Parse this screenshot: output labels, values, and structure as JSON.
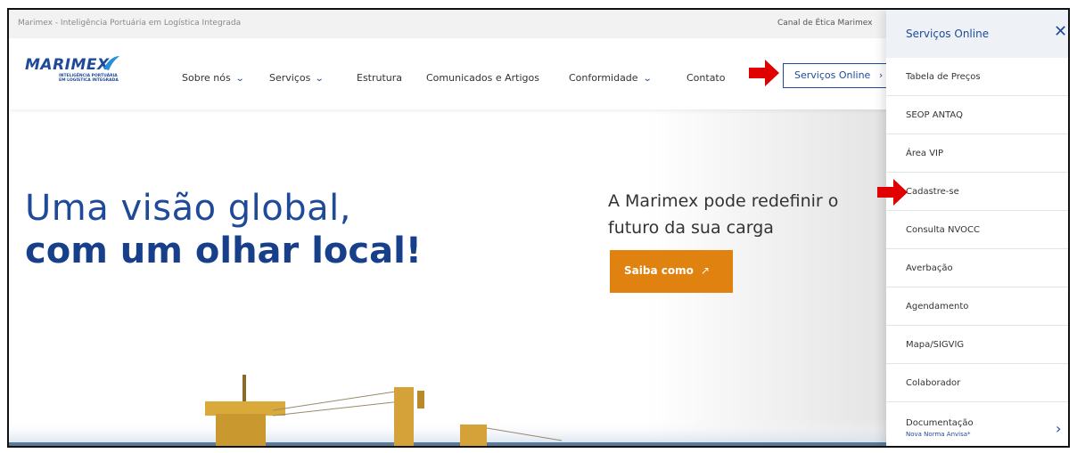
{
  "topbar": {
    "tagline": "Marimex - Inteligência Portuária em Logística Integrada",
    "ethics_link": "Canal de Ética Marimex"
  },
  "logo": {
    "name": "MARIMEX",
    "subtitle_line1": "INTELIGÊNCIA PORTUÁRIA",
    "subtitle_line2": "EM LOGÍSTICA INTEGRADA"
  },
  "nav": {
    "items": [
      {
        "label": "Sobre nós",
        "dropdown": true
      },
      {
        "label": "Serviços",
        "dropdown": true
      },
      {
        "label": "Estrutura",
        "dropdown": false
      },
      {
        "label": "Comunicados e Artigos",
        "dropdown": false
      },
      {
        "label": "Conformidade",
        "dropdown": true
      },
      {
        "label": "Contato",
        "dropdown": false
      }
    ],
    "online_button": "Serviços Online",
    "online_button_icon": "chevron-right-icon"
  },
  "hero": {
    "headline_light": "Uma visão global,",
    "headline_bold": "com um olhar local!",
    "lead": "A Marimex pode redefinir o futuro da sua carga",
    "cta_label": "Saiba como",
    "cta_icon": "arrow-up-right-icon"
  },
  "panel": {
    "title": "Serviços Online",
    "close_icon": "close-icon",
    "items": [
      {
        "label": "Tabela de Preços"
      },
      {
        "label": "SEOP ANTAQ"
      },
      {
        "label": "Área VIP"
      },
      {
        "label": "Cadastre-se"
      },
      {
        "label": "Consulta NVOCC"
      },
      {
        "label": "Averbação"
      },
      {
        "label": "Agendamento"
      },
      {
        "label": "Mapa/SIGVIG"
      },
      {
        "label": "Colaborador"
      },
      {
        "label": "Documentação",
        "sublabel": "Nova Norma Anvisa*"
      }
    ]
  },
  "colors": {
    "brand_blue": "#1f4a9a",
    "cta_orange": "#e0820f",
    "annotation_red": "#e00000"
  }
}
